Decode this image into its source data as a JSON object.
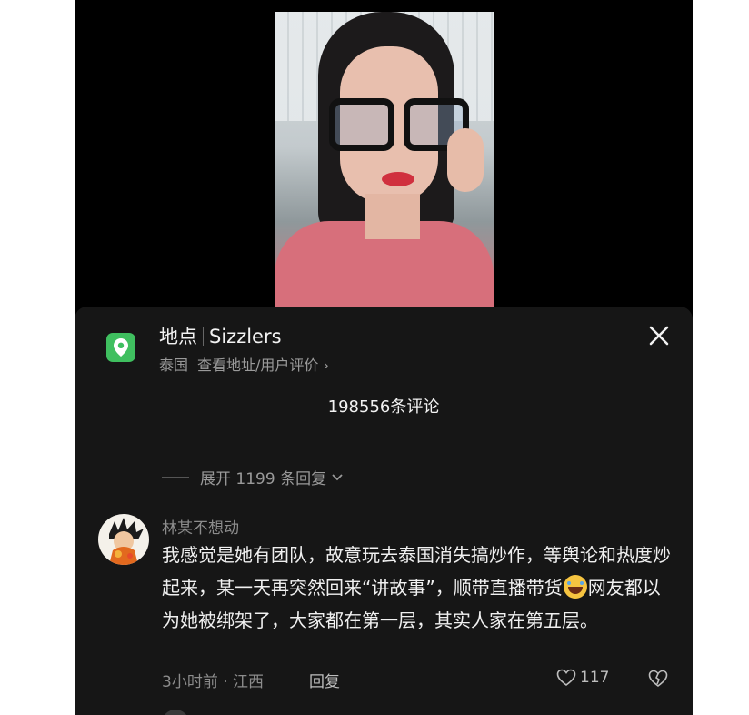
{
  "location": {
    "label": "地点",
    "name": "Sizzlers",
    "country": "泰国",
    "link": "查看地址/用户评价",
    "link_chevron": "›"
  },
  "comments_header": {
    "count_text": "198556条评论"
  },
  "thread": {
    "expand_text": "展开 1199 条回复",
    "expand_chevron": "⌄"
  },
  "comment": {
    "user": "林某不想动",
    "text_part1": "我感觉是她有团队，故意玩去泰国消失搞炒作，等舆论和热度炒起来，某一天再突然回来“讲故事”，顺带直播带货",
    "text_part2": "网友都以为她被绑架了，大家都在第一层，其实人家在第五层。",
    "emoji_icon": "crying-laughing-emoji",
    "meta": "3小时前 · 江西",
    "reply_label": "回复",
    "likes": "117"
  },
  "colors": {
    "accent_green": "#3fbf5f",
    "sheet_bg": "#161616",
    "muted_text": "#8c8c8c"
  }
}
